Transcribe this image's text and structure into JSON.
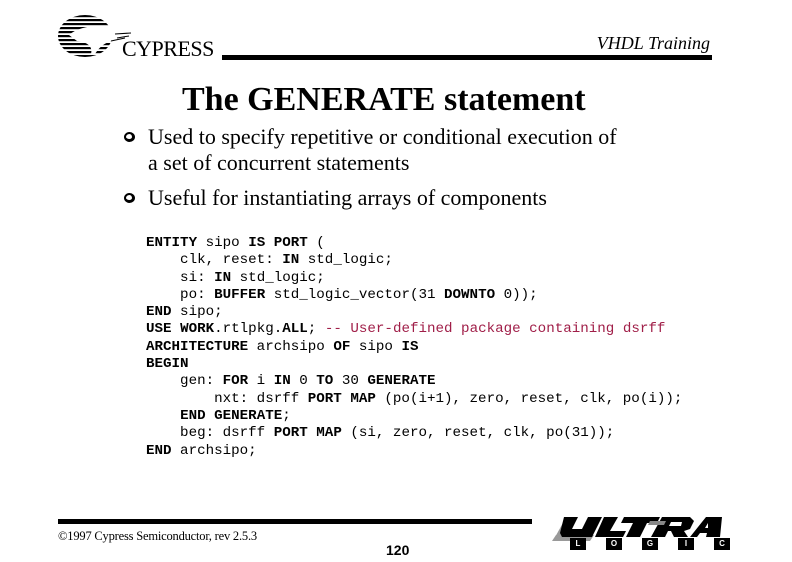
{
  "header": {
    "company_logo_text": "CYPRESS",
    "course_title": "VHDL Training"
  },
  "slide": {
    "title": "The GENERATE statement",
    "bullets": [
      {
        "icon": "hollow-circle-bullet",
        "text": "Used to specify repetitive or conditional execution of\na set of concurrent statements"
      },
      {
        "icon": "hollow-circle-bullet",
        "text": "Useful for instantiating arrays of components"
      }
    ],
    "code": {
      "language": "VHDL",
      "comment_color": "#a01e48",
      "lines": [
        [
          {
            "t": "ENTITY",
            "k": "kw"
          },
          {
            "t": " sipo "
          },
          {
            "t": "IS",
            "k": "kw"
          },
          {
            "t": " "
          },
          {
            "t": "PORT",
            "k": "kw"
          },
          {
            "t": " ("
          }
        ],
        [
          {
            "t": "    clk, reset: "
          },
          {
            "t": "IN",
            "k": "kw"
          },
          {
            "t": " std_logic;"
          }
        ],
        [
          {
            "t": "    si: "
          },
          {
            "t": "IN",
            "k": "kw"
          },
          {
            "t": " std_logic;"
          }
        ],
        [
          {
            "t": "    po: "
          },
          {
            "t": "BUFFER",
            "k": "kw"
          },
          {
            "t": " std_logic_vector(31 "
          },
          {
            "t": "DOWNTO",
            "k": "kw"
          },
          {
            "t": " 0));"
          }
        ],
        [
          {
            "t": "END",
            "k": "kw"
          },
          {
            "t": " sipo;"
          }
        ],
        [
          {
            "t": "USE",
            "k": "kw"
          },
          {
            "t": " "
          },
          {
            "t": "WORK",
            "k": "kw"
          },
          {
            "t": ".rtlpkg."
          },
          {
            "t": "ALL",
            "k": "kw"
          },
          {
            "t": "; "
          },
          {
            "t": "-- User-defined package containing dsrff",
            "k": "cm"
          }
        ],
        [
          {
            "t": "ARCHITECTURE",
            "k": "kw"
          },
          {
            "t": " archsipo "
          },
          {
            "t": "OF",
            "k": "kw"
          },
          {
            "t": " sipo "
          },
          {
            "t": "IS",
            "k": "kw"
          }
        ],
        [
          {
            "t": "BEGIN",
            "k": "kw"
          }
        ],
        [
          {
            "t": "    gen: "
          },
          {
            "t": "FOR",
            "k": "kw"
          },
          {
            "t": " i "
          },
          {
            "t": "IN",
            "k": "kw"
          },
          {
            "t": " 0 "
          },
          {
            "t": "TO",
            "k": "kw"
          },
          {
            "t": " 30 "
          },
          {
            "t": "GENERATE",
            "k": "kw"
          }
        ],
        [
          {
            "t": "        nxt: dsrff "
          },
          {
            "t": "PORT",
            "k": "kw"
          },
          {
            "t": " "
          },
          {
            "t": "MAP",
            "k": "kw"
          },
          {
            "t": " (po(i+1), zero, reset, clk, po(i));"
          }
        ],
        [
          {
            "t": "    "
          },
          {
            "t": "END",
            "k": "kw"
          },
          {
            "t": " "
          },
          {
            "t": "GENERATE",
            "k": "kw"
          },
          {
            "t": ";"
          }
        ],
        [
          {
            "t": "    beg: dsrff "
          },
          {
            "t": "PORT",
            "k": "kw"
          },
          {
            "t": " "
          },
          {
            "t": "MAP",
            "k": "kw"
          },
          {
            "t": " (si, zero, reset, clk, po(31));"
          }
        ],
        [
          {
            "t": "END",
            "k": "kw"
          },
          {
            "t": " archsipo;"
          }
        ]
      ]
    }
  },
  "footer": {
    "copyright": "©1997 Cypress Semiconductor, rev 2.5.3",
    "page_number": "120",
    "product_logo": {
      "word": "ULTRA",
      "letters": [
        "L",
        "O",
        "G",
        "I",
        "C"
      ]
    }
  }
}
